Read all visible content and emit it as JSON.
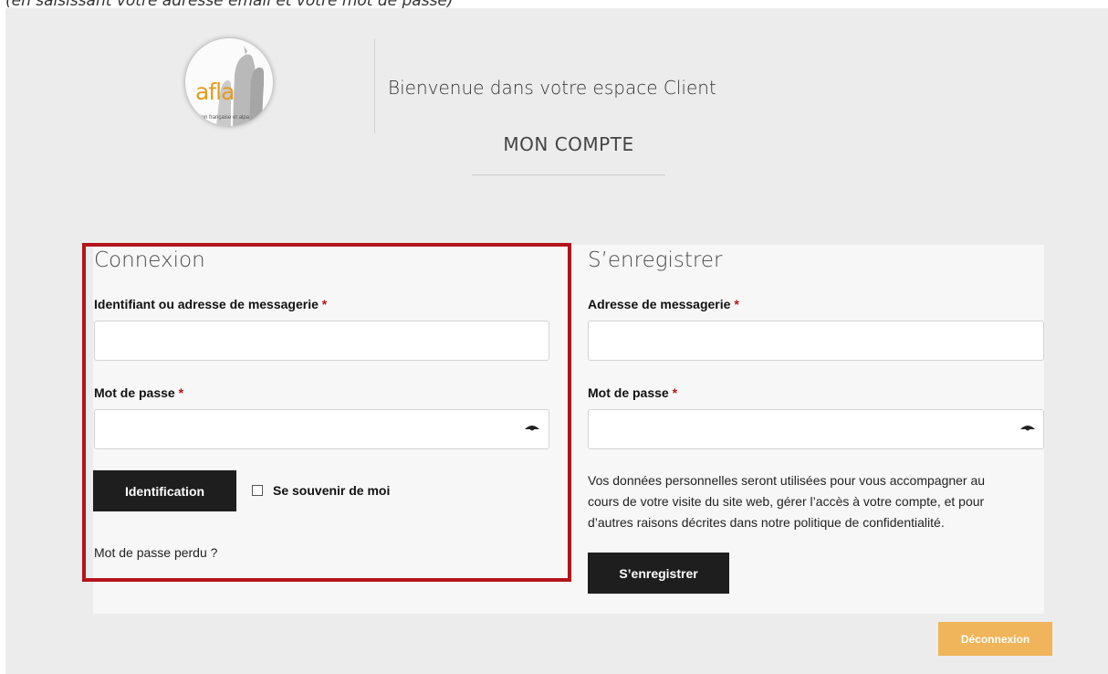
{
  "caption": "(en saisissant votre adresse email et votre mot de passe)",
  "header": {
    "logo_text": "afla",
    "logo_tagline": "ciation française et alpa",
    "welcome": "Bienvenue dans votre espace Client",
    "title": "MON COMPTE"
  },
  "login": {
    "title": "Connexion",
    "username_label": "Identifiant ou adresse de messagerie",
    "username_value": "",
    "password_label": "Mot de passe",
    "password_value": "",
    "required_mark": "*",
    "submit_label": "Identification",
    "remember_label": "Se souvenir de moi",
    "lost_password": "Mot de passe perdu ?"
  },
  "register": {
    "title": "S’enregistrer",
    "email_label": "Adresse de messagerie",
    "email_value": "",
    "password_label": "Mot de passe",
    "password_value": "",
    "required_mark": "*",
    "privacy_text": "Vos données personnelles seront utilisées pour vous accompagner au cours de votre visite du site web, gérer l’accès à votre compte, et pour d’autres raisons décrites dans notre ",
    "privacy_link": "politique de confidentialité",
    "privacy_end": ".",
    "submit_label": "S’enregistrer"
  },
  "logout_label": "Déconnexion",
  "colors": {
    "highlight": "#b4141b",
    "dark_button": "#1e1e1e",
    "logout_button": "#f0b45a",
    "page_background": "#ececec"
  },
  "icons": {
    "password_toggle": "eye-icon",
    "remember": "checkbox-icon"
  }
}
